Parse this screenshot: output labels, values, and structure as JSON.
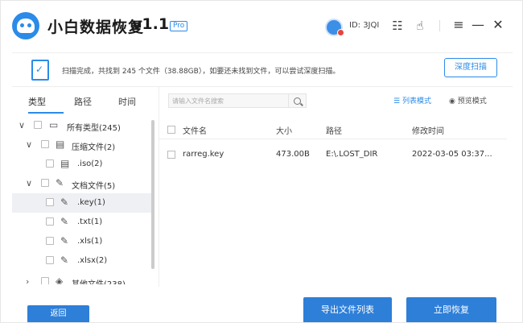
{
  "app": {
    "name": "小白数据恢复",
    "version": "v1.1",
    "badge": "Pro",
    "user_id": "ID: 3JQI"
  },
  "summary": {
    "text": "扫描完成，共找到 245 个文件（38.88GB），如要还未找到文件，可以尝试深度扫描。",
    "deep_scan_label": "深度扫描"
  },
  "tabs": [
    "类型",
    "路径",
    "时间"
  ],
  "tree": [
    {
      "label": "所有类型(245)",
      "icon": "hdd-icon"
    },
    {
      "label": "压缩文件(2)",
      "icon": "archive-icon"
    },
    {
      "label": ".iso(2)",
      "icon": "archive-icon"
    },
    {
      "label": "文档文件(5)",
      "icon": "document-icon"
    },
    {
      "label": ".key(1)",
      "icon": "document-icon"
    },
    {
      "label": ".txt(1)",
      "icon": "document-icon"
    },
    {
      "label": ".xls(1)",
      "icon": "document-icon"
    },
    {
      "label": ".xlsx(2)",
      "icon": "document-icon"
    },
    {
      "label": "其他文件(238)",
      "icon": "other-icon"
    }
  ],
  "search": {
    "placeholder": "请输入文件名搜索"
  },
  "view_modes": {
    "list": "列表模式",
    "preview": "预览模式"
  },
  "table": {
    "headers": [
      "文件名",
      "大小",
      "路径",
      "修改时间"
    ],
    "rows": [
      [
        "rarreg.key",
        "473.00B",
        "E:\\.LOST_DIR",
        "2022-03-05 03:37..."
      ]
    ]
  },
  "footer": {
    "back": "返回",
    "export": "导出文件列表",
    "recover": "立即恢复"
  },
  "colors": {
    "accent": "#2b8be8",
    "button": "#2e7fd8"
  }
}
